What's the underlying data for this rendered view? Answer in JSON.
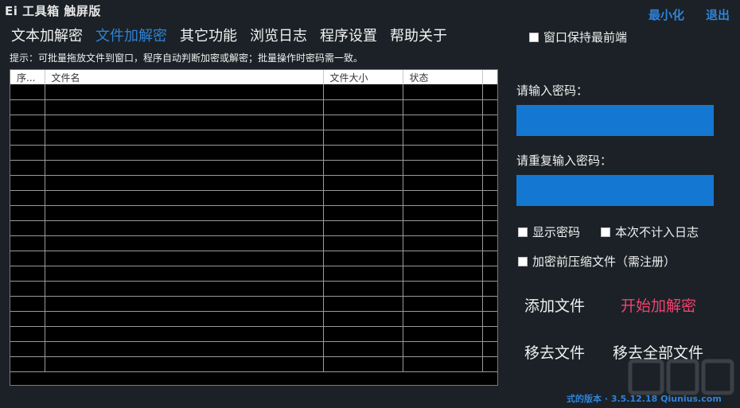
{
  "app": {
    "title": "Ei 工具箱 触屏版"
  },
  "window": {
    "minimize": "最小化",
    "exit": "退出"
  },
  "tabs": [
    {
      "label": "文本加解密",
      "active": false
    },
    {
      "label": "文件加解密",
      "active": true
    },
    {
      "label": "其它功能",
      "active": false
    },
    {
      "label": "浏览日志",
      "active": false
    },
    {
      "label": "程序设置",
      "active": false
    },
    {
      "label": "帮助关于",
      "active": false
    }
  ],
  "hint": "提示：可批量拖放文件到窗口，程序自动判断加密或解密；批量操作时密码需一致。",
  "file_table": {
    "columns": [
      "序...",
      "文件名",
      "文件大小",
      "状态"
    ],
    "rows": []
  },
  "options": {
    "keep_on_top": "窗口保持最前端",
    "show_password": "显示密码",
    "no_log": "本次不计入日志",
    "compress": "加密前压缩文件（需注册）"
  },
  "password": {
    "label": "请输入密码：",
    "value": ""
  },
  "password_confirm": {
    "label": "请重复输入密码：",
    "value": ""
  },
  "actions": {
    "add_file": "添加文件",
    "start": "开始加解密",
    "remove_file": "移去文件",
    "remove_all": "移去全部文件"
  },
  "version": "式的版本 · 3.5.12.18 Qiunius.com",
  "colors": {
    "background": "#1b2126",
    "accent": "#2f82d8",
    "input": "#1478d2",
    "start": "#f0426f"
  }
}
